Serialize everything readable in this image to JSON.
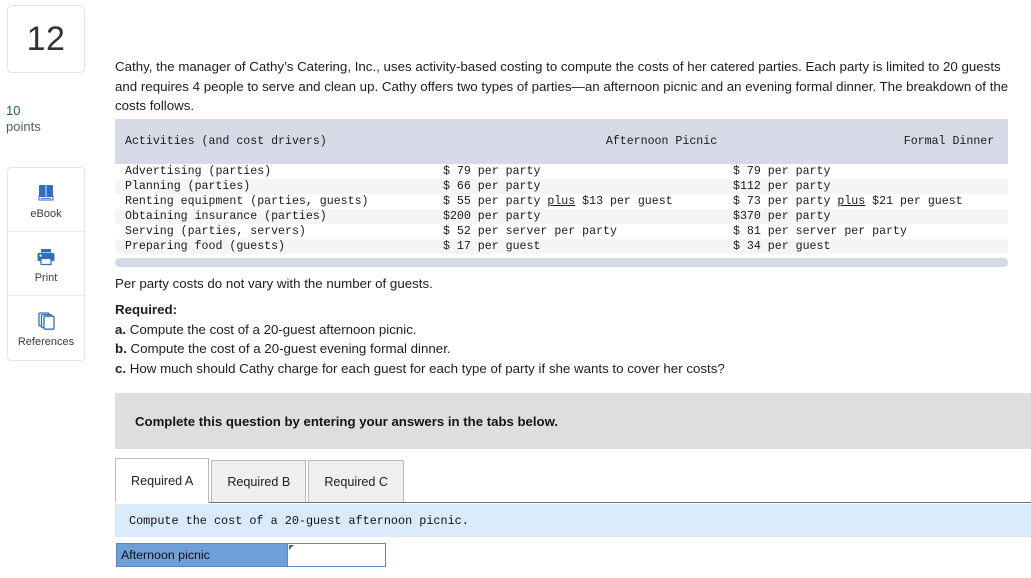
{
  "sidebar": {
    "question_number": "12",
    "points_value": "10",
    "points_label": "points",
    "tools": [
      {
        "icon": "book-icon",
        "label": "eBook"
      },
      {
        "icon": "printer-icon",
        "label": "Print"
      },
      {
        "icon": "pages-icon",
        "label": "References"
      }
    ]
  },
  "main": {
    "intro": "Cathy, the manager of Cathy’s Catering, Inc., uses activity-based costing to compute the costs of her catered parties. Each party is limited to 20 guests and requires 4 people to serve and clean up. Cathy offers two types of parties—an afternoon picnic and an evening formal dinner. The breakdown of the costs follows.",
    "note": "Per party costs do not vary with the number of guests.",
    "required_heading": "Required:",
    "required_items": [
      {
        "letter": "a.",
        "text": "Compute the cost of a 20-guest afternoon picnic."
      },
      {
        "letter": "b.",
        "text": "Compute the cost of a 20-guest evening formal dinner."
      },
      {
        "letter": "c.",
        "text": "How much should Cathy charge for each guest for each type of party if she wants to cover her costs?"
      }
    ]
  },
  "cost_table": {
    "headers": [
      "Activities (and cost drivers)",
      "Afternoon Picnic",
      "Formal Dinner"
    ],
    "rows": [
      {
        "activity": "Advertising (parties)",
        "picnic": {
          "pre": "$ 79 per party",
          "underline": "",
          "post": ""
        },
        "dinner": {
          "pre": "$ 79 per party",
          "underline": "",
          "post": ""
        }
      },
      {
        "activity": "Planning (parties)",
        "picnic": {
          "pre": "$ 66 per party",
          "underline": "",
          "post": ""
        },
        "dinner": {
          "pre": "$112 per party",
          "underline": "",
          "post": ""
        }
      },
      {
        "activity": "Renting equipment (parties, guests)",
        "picnic": {
          "pre": "$ 55 per party ",
          "underline": "plus",
          "post": " $13 per guest"
        },
        "dinner": {
          "pre": "$ 73 per party ",
          "underline": "plus",
          "post": " $21 per guest"
        }
      },
      {
        "activity": "Obtaining insurance (parties)",
        "picnic": {
          "pre": "$200 per party",
          "underline": "",
          "post": ""
        },
        "dinner": {
          "pre": "$370 per party",
          "underline": "",
          "post": ""
        }
      },
      {
        "activity": "Serving (parties, servers)",
        "picnic": {
          "pre": "$ 52 per server per party",
          "underline": "",
          "post": ""
        },
        "dinner": {
          "pre": "$ 81 per server per party",
          "underline": "",
          "post": ""
        }
      },
      {
        "activity": "Preparing food (guests)",
        "picnic": {
          "pre": "$ 17 per guest",
          "underline": "",
          "post": ""
        },
        "dinner": {
          "pre": "$ 34 per guest",
          "underline": "",
          "post": ""
        }
      }
    ]
  },
  "answer_widget": {
    "banner_text": "Complete this question by entering your answers in the tabs below.",
    "tabs": [
      {
        "label": "Required A",
        "active": true
      },
      {
        "label": "Required B",
        "active": false
      },
      {
        "label": "Required C",
        "active": false
      }
    ],
    "prompt": "Compute the cost of a 20-guest afternoon picnic.",
    "answer_row_label": "Afternoon picnic",
    "answer_value": "",
    "answer_placeholder": ""
  },
  "colors": {
    "accent_blue": "#1c5a94",
    "icon_blue": "#2f6fbd",
    "table_header": "#d6dae6",
    "table_stripe": "#f4f5f7",
    "banner_gray": "#dedede",
    "prompt_blue": "#d9ebfa",
    "answer_cell_blue": "#6f9fd8"
  }
}
